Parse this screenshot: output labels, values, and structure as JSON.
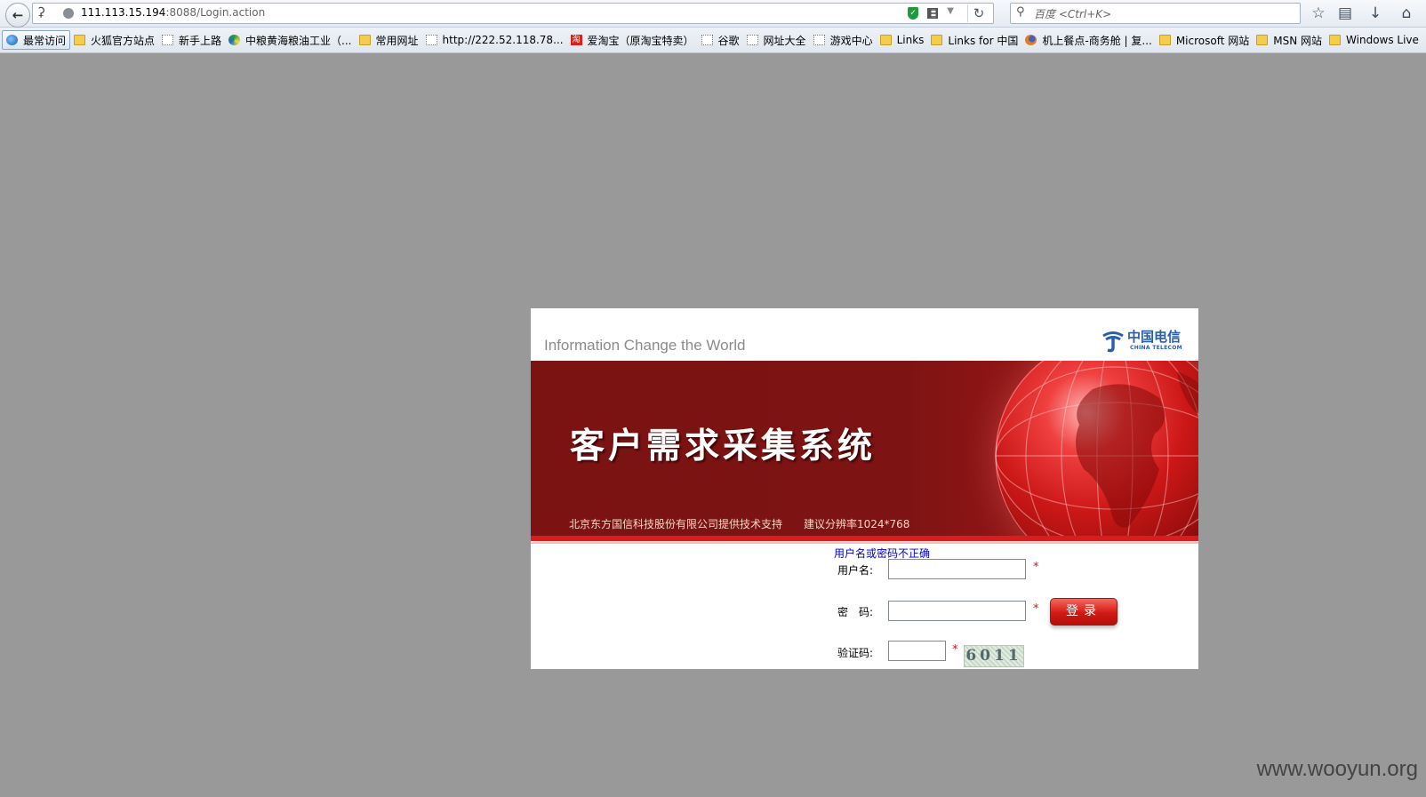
{
  "browser": {
    "url_host": "111.113.15.194",
    "url_path": ":8088/Login.action",
    "search_placeholder": "百度 <Ctrl+K>"
  },
  "bookmarks": [
    {
      "label": "最常访问",
      "icon": "globe-icon"
    },
    {
      "label": "火狐官方站点",
      "icon": "folder-icon"
    },
    {
      "label": "新手上路",
      "icon": "page-icon"
    },
    {
      "label": "中粮黄海粮油工业（...",
      "icon": "spiral-icon"
    },
    {
      "label": "常用网址",
      "icon": "folder-icon"
    },
    {
      "label": "http://222.52.118.78...",
      "icon": "page-icon"
    },
    {
      "label": "爱淘宝（原淘宝特卖）",
      "icon": "taobao-icon"
    },
    {
      "label": "谷歌",
      "icon": "page-icon"
    },
    {
      "label": "网址大全",
      "icon": "page-icon"
    },
    {
      "label": "游戏中心",
      "icon": "page-icon"
    },
    {
      "label": "Links",
      "icon": "folder-icon"
    },
    {
      "label": "Links for 中国",
      "icon": "folder-icon"
    },
    {
      "label": "机上餐点-商务舱 | 复...",
      "icon": "firefox-icon"
    },
    {
      "label": "Microsoft 网站",
      "icon": "folder-icon"
    },
    {
      "label": "MSN 网站",
      "icon": "folder-icon"
    },
    {
      "label": "Windows Live",
      "icon": "folder-icon"
    }
  ],
  "login": {
    "tagline": "Information Change the World",
    "logo_cn": "中国电信",
    "logo_en": "CHINA TELECOM",
    "title": "客户需求采集系统",
    "support": "北京东方国信科技股份有限公司提供技术支持",
    "resolution": "建议分辨率1024*768",
    "error": "用户名或密码不正确",
    "username_label": "用户名:",
    "password_label": "密　码:",
    "captcha_label": "验证码:",
    "required_mark": "*",
    "username_value": "",
    "password_value": "",
    "captcha_value": "",
    "login_button": "登录",
    "captcha_text": "6011"
  },
  "watermark": "www.wooyun.org",
  "colors": {
    "banner": "#7c1313",
    "accent_red": "#d91d1d",
    "error_blue": "#0000cc",
    "logo_blue": "#2a5ea8"
  }
}
